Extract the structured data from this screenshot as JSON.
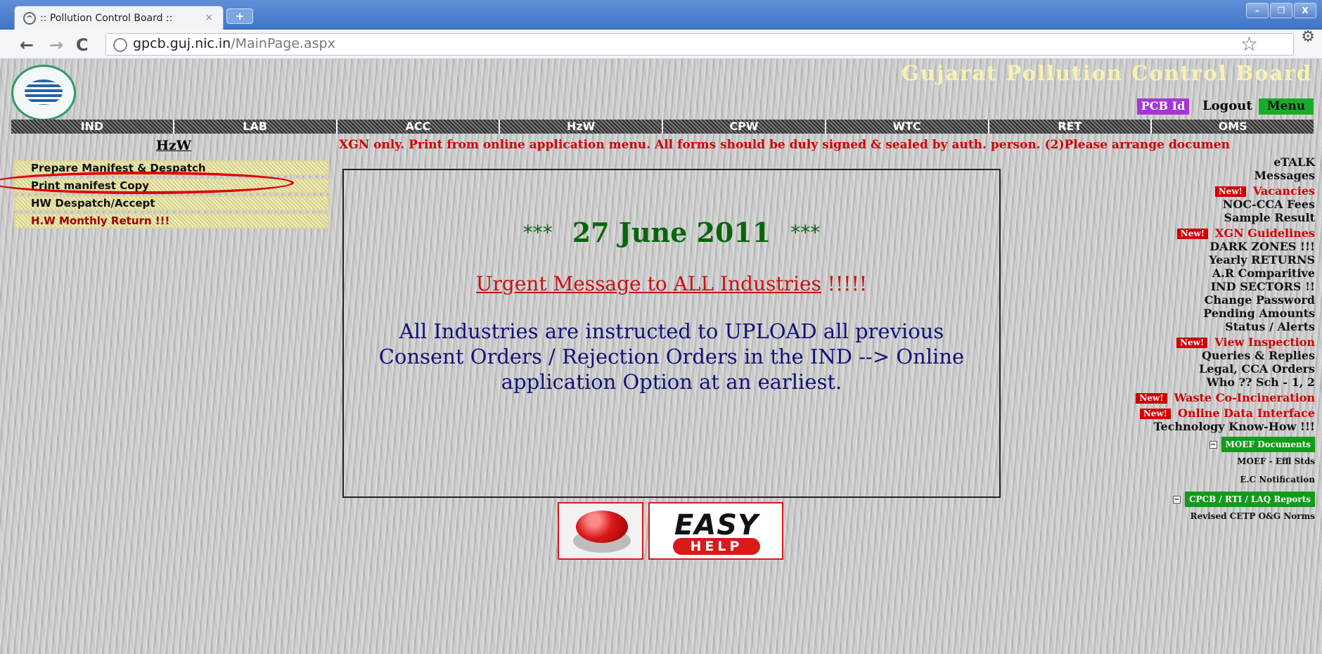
{
  "browser": {
    "tab_title": ":: Pollution Control Board ::",
    "tab_close": "×",
    "new_tab": "+",
    "url_host": "gpcb.guj.nic.in",
    "url_path": "/MainPage.aspx",
    "window": {
      "minimize": "–",
      "maximize": "❐",
      "close": "X"
    }
  },
  "header": {
    "title": "Gujarat Pollution Control Board",
    "pcb_id": "PCB Id",
    "logout": "Logout",
    "menu": "Menu"
  },
  "nav": [
    "IND",
    "LAB",
    "ACC",
    "HzW",
    "CPW",
    "WTC",
    "RET",
    "OMS"
  ],
  "hzw": {
    "title": "HzW",
    "items": [
      "Prepare Manifest & Despatch",
      "Print manifest Copy",
      "HW Despatch/Accept",
      "H.W Monthly Return !!!"
    ]
  },
  "ticker": "XGN only. Print from online application menu. All forms should be duly signed & sealed by auth. person. (2)Please arrange documen",
  "message": {
    "stars": "***",
    "date": "27 June 2011",
    "urgent": "Urgent Message to ALL Industries",
    "urgent_bang": " !!!!!",
    "body": "All Industries  are instructed to UPLOAD all previous Consent Orders / Rejection Orders  in the IND --> Online application Option at an earliest."
  },
  "easy_help": {
    "easy": "EASY",
    "help": "HELP"
  },
  "right_links": {
    "new_badge": "New!",
    "etalk": "eTALK",
    "messages": "Messages",
    "vacancies": "Vacancies",
    "noc_cca_fees": "NOC-CCA Fees",
    "sample_result": "Sample Result",
    "xgn_guidelines": "XGN Guidelines",
    "dark_zones": "DARK ZONES !!!",
    "yearly_returns": "Yearly RETURNS",
    "ar_comparitive": "A.R Comparitive",
    "ind_sectors": "IND SECTORS !!",
    "change_password": "Change Password",
    "pending_amounts": "Pending Amounts",
    "status_alerts": "Status / Alerts",
    "view_inspection": "View Inspection",
    "queries_replies": "Queries & Replies",
    "legal_cca": "Legal, CCA Orders",
    "who_sch": "Who ?? Sch - 1, 2",
    "waste_coinc": "Waste Co-Incineration",
    "online_data": "Online Data Interface",
    "tech_knowhow": "Technology Know-How !!!",
    "moef_docs": "MOEF Documents",
    "moef_effl": "MOEF - Effl Stds",
    "ec_notification": "E.C Notification",
    "cpcb_reports": "CPCB / RTI / LAQ Reports",
    "revised_cetp": "Revised CETP O&G Norms"
  },
  "colors": {
    "ticker_red": "#d10000",
    "date_green": "#07650c",
    "body_navy": "#11117a",
    "menu_green": "#17ad2a",
    "pcb_purple": "#a636d8"
  }
}
